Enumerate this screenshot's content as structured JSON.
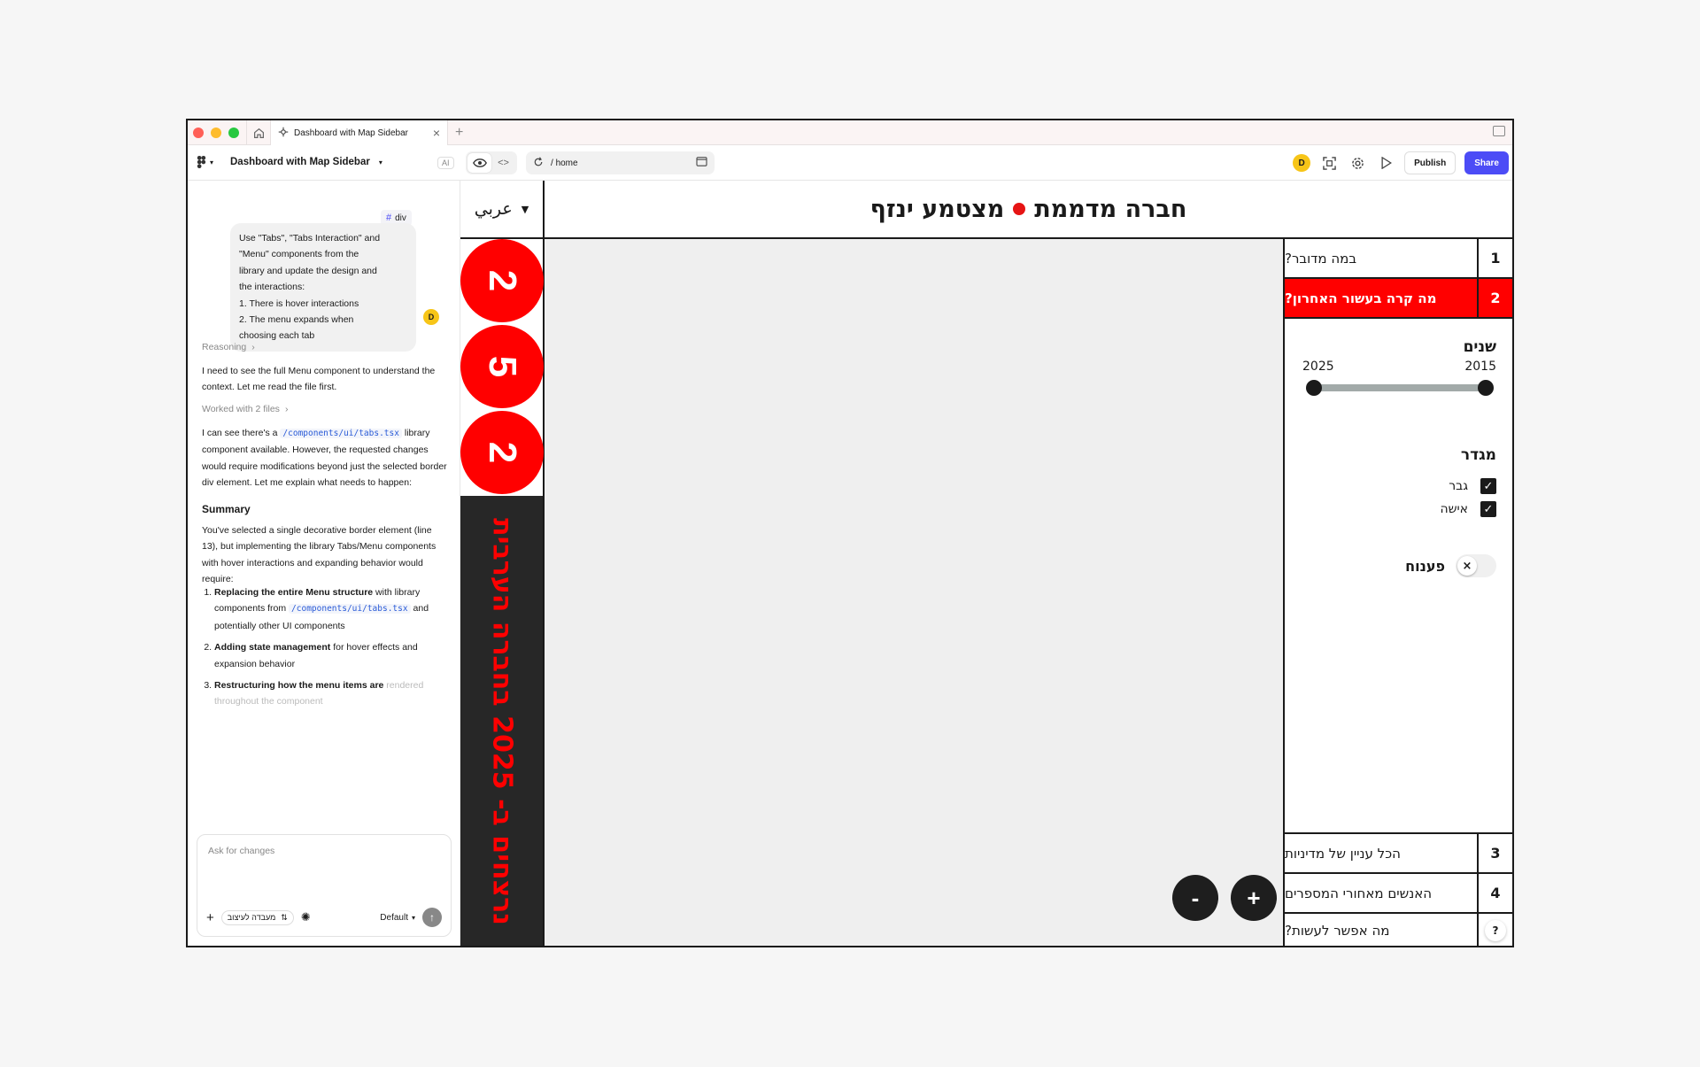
{
  "browser": {
    "tab_title": "Dashboard with Map Sidebar",
    "new_tab": "+"
  },
  "toolbar": {
    "project_title": "Dashboard with Map Sidebar",
    "ai_badge": "AI",
    "url_path": "home",
    "url_sep": "/",
    "avatar_initial": "D",
    "publish_label": "Publish",
    "share_label": "Share"
  },
  "chat": {
    "selected_chip": "div",
    "user_message_lines": [
      "Use \"Tabs\", \"Tabs Interaction\" and",
      "\"Menu\" components from the",
      "library and update the design and",
      "the interactions:",
      "1. There is hover interactions",
      "2. The menu expands when",
      "choosing each tab"
    ],
    "user_avatar": "D",
    "reasoning_label": "Reasoning",
    "intro": "I need to see the full Menu component to understand the context. Let me read the file first.",
    "worked_label": "Worked with 2 files",
    "found_prefix": "I can see there's a",
    "found_code": "/components/ui/tabs.tsx",
    "found_suffix": "library component available. However, the requested changes would require modifications beyond just the selected border div element. Let me explain what needs to happen:",
    "summary_heading": "Summary",
    "summary_text": "You've selected a single decorative border element (line 13), but implementing the library Tabs/Menu components with hover interactions and expanding behavior would require:",
    "step1_bold": "Replacing the entire Menu structure",
    "step1_rest": "with library components from",
    "step1_code": "/components/ui/tabs.tsx",
    "step1_tail": "and potentially other UI components",
    "step2_bold": "Adding state management",
    "step2_rest": "for hover effects and expansion behavior",
    "step3_bold": "Restructuring how the menu items are",
    "step3_fade": "rendered throughout the component",
    "compose_placeholder": "Ask for changes",
    "compose_pill": "מעבדה לעיצוב",
    "model_label": "Default"
  },
  "app": {
    "language_label": "عربي",
    "header_part1": "חברה מדממת",
    "header_part2": "מצטמע ינזף",
    "year_digits": [
      "2",
      "5",
      "2"
    ],
    "banner_text": "נרצחים ב- 2025 בחברה הערבית",
    "zoom_minus": "-",
    "zoom_plus": "+",
    "accent_color": "#ff0000",
    "menu": [
      {
        "num": "1",
        "label": "במה מדובר?"
      },
      {
        "num": "2",
        "label": "מה קרה בעשור האחרון?",
        "active": true
      },
      {
        "num": "3",
        "label": "הכל עניין של מדיניות"
      },
      {
        "num": "4",
        "label": "האנשים מאחורי המספרים"
      },
      {
        "num": "?",
        "label": "מה אפשר לעשות?"
      }
    ],
    "filters": {
      "years_title": "שנים",
      "year_start": "2015",
      "year_end": "2025",
      "gender_title": "מגדר",
      "gender_options": [
        "גבר",
        "אישה"
      ],
      "toggle_label": "פענוח"
    }
  }
}
